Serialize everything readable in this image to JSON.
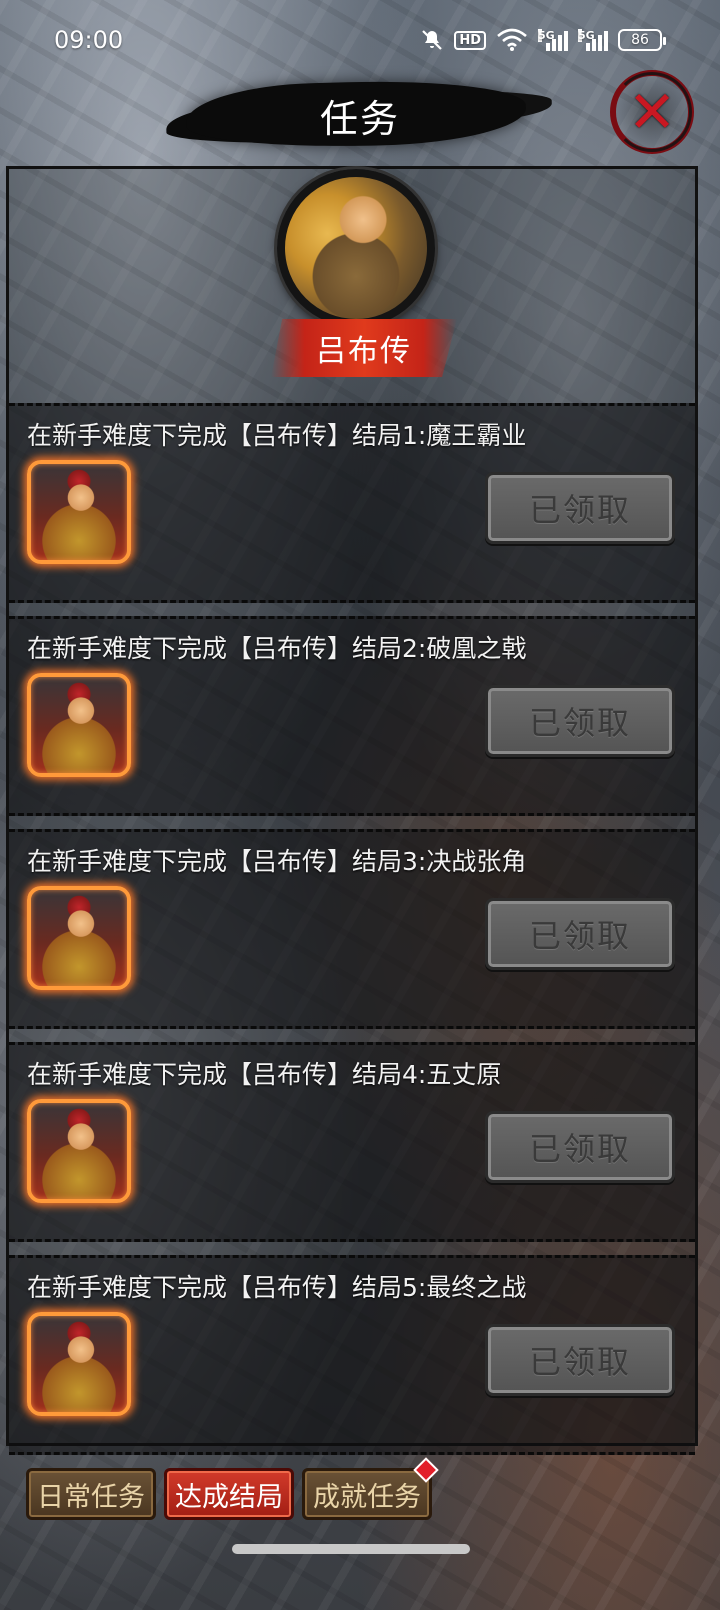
{
  "status_bar": {
    "time": "09:00",
    "icons": [
      "mute-icon",
      "hd-icon",
      "wifi-icon",
      "signal-5g-icon",
      "signal-5g-icon",
      "battery-icon"
    ],
    "hd_label": "HD",
    "net_label": "5G",
    "battery": "86"
  },
  "header": {
    "title": "任务",
    "close_icon": "close-icon"
  },
  "hero": {
    "name": "吕布传"
  },
  "tasks": [
    {
      "description": "在新手难度下完成【吕布传】结局1:魔王霸业",
      "button": "已领取",
      "state": "claimed"
    },
    {
      "description": "在新手难度下完成【吕布传】结局2:破凰之戟",
      "button": "已领取",
      "state": "claimed"
    },
    {
      "description": "在新手难度下完成【吕布传】结局3:决战张角",
      "button": "已领取",
      "state": "claimed"
    },
    {
      "description": "在新手难度下完成【吕布传】结局4:五丈原",
      "button": "已领取",
      "state": "claimed"
    },
    {
      "description": "在新手难度下完成【吕布传】结局5:最终之战",
      "button": "已领取",
      "state": "claimed"
    }
  ],
  "tabs": [
    {
      "label": "日常任务",
      "active": false,
      "badge": false
    },
    {
      "label": "达成结局",
      "active": true,
      "badge": false
    },
    {
      "label": "成就任务",
      "active": false,
      "badge": true
    }
  ],
  "colors": {
    "active_tab": "#c42418",
    "claimed_button": "#5e5e5e",
    "reward_glow": "#ff9a3a",
    "close_accent": "#c81822"
  }
}
